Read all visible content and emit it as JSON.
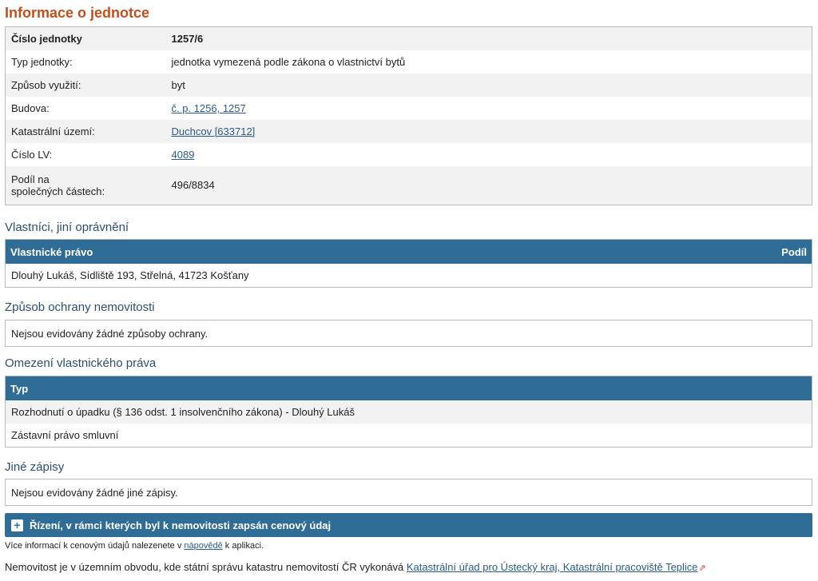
{
  "page_title": "Informace o jednotce",
  "unit_info": {
    "rows": [
      {
        "label": "Číslo jednotky",
        "value": "1257/6"
      },
      {
        "label": "Typ jednotky:",
        "value": "jednotka vymezená podle zákona o vlastnictví bytů"
      },
      {
        "label": "Způsob využití:",
        "value": "byt"
      },
      {
        "label": "Budova:",
        "value": "č. p. 1256, 1257"
      },
      {
        "label": "Katastrální území:",
        "value": "Duchcov [633712]"
      },
      {
        "label": "Číslo LV:",
        "value": "4089"
      },
      {
        "label_line1": "Podíl na",
        "label_line2": "společných částech:",
        "value": "496/8834"
      }
    ]
  },
  "owners": {
    "title": "Vlastníci, jiní oprávnění",
    "header_left": "Vlastnické právo",
    "header_right": "Podíl",
    "rows": [
      "Dlouhý Lukáš, Sídliště 193, Střelná, 41723 Košťany"
    ]
  },
  "protection": {
    "title": "Způsob ochrany nemovitosti",
    "text": "Nejsou evidovány žádné způsoby ochrany."
  },
  "restrictions": {
    "title": "Omezení vlastnického práva",
    "header": "Typ",
    "rows": [
      "Rozhodnutí o úpadku (§ 136 odst. 1 insolvenčního zákona) - Dlouhý Lukáš",
      "Zástavní právo smluvní"
    ]
  },
  "other_records": {
    "title": "Jiné zápisy",
    "text": "Nejsou evidovány žádné jiné zápisy."
  },
  "price_section": {
    "label": "Řízení, v rámci kterých byl k nemovitosti zapsán cenový údaj",
    "icon": "plus-icon"
  },
  "help_note": {
    "before": "Více informací k cenovým údajů nalezenete v ",
    "link": "nápovědě",
    "after": " k aplikaci."
  },
  "footer": {
    "text": "Nemovitost je v územním obvodu, kde státní správu katastru nemovitostí ČR vykonává ",
    "link": "Katastrální úřad pro Ústecký kraj, Katastrální pracoviště Teplice",
    "icon": "external-link-icon"
  },
  "colors": {
    "title_orange": "#c0501c",
    "section_blue": "#2b4f73",
    "band_blue": "#2f6d96",
    "link_blue": "#2a5b8e"
  }
}
